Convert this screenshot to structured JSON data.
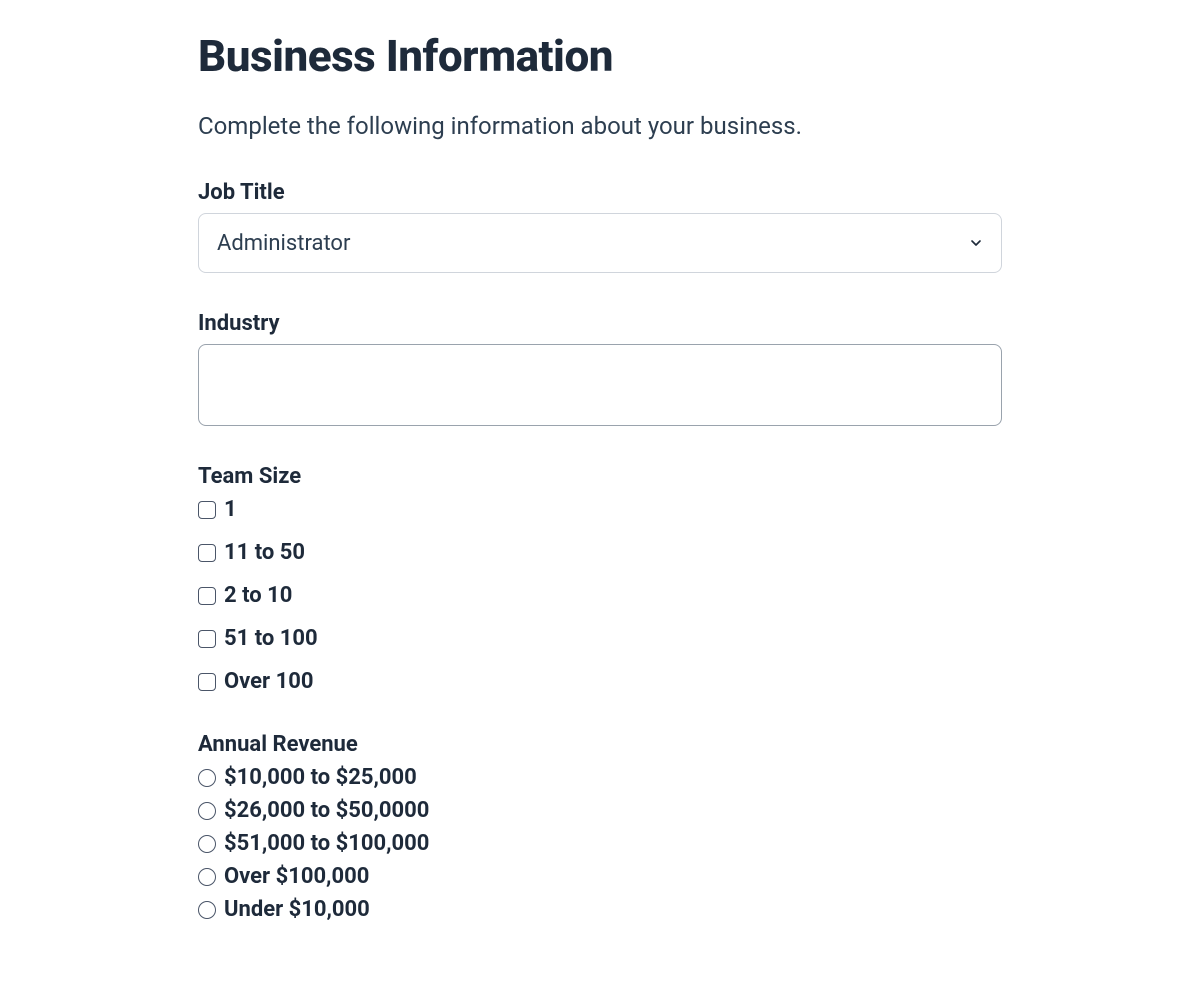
{
  "page": {
    "title": "Business Information",
    "description": "Complete the following information about your business."
  },
  "jobTitle": {
    "label": "Job Title",
    "selected": "Administrator"
  },
  "industry": {
    "label": "Industry",
    "value": ""
  },
  "teamSize": {
    "label": "Team Size",
    "options": [
      "1",
      "11 to 50",
      "2 to 10",
      "51 to 100",
      "Over 100"
    ]
  },
  "annualRevenue": {
    "label": "Annual Revenue",
    "options": [
      "$10,000 to $25,000",
      "$26,000 to $50,0000",
      "$51,000 to $100,000",
      "Over $100,000",
      "Under $10,000"
    ]
  }
}
